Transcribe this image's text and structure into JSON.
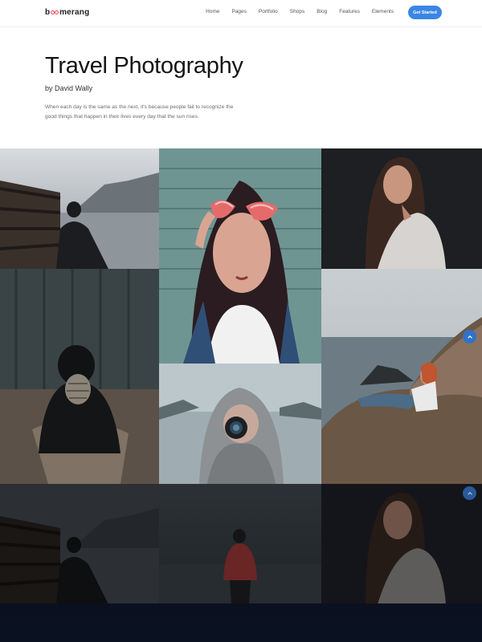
{
  "header": {
    "logo": {
      "prefix": "b",
      "suffix": "merang"
    },
    "nav": [
      "Home",
      "Pages",
      "Portfolio",
      "Shops",
      "Blog",
      "Features",
      "Elements"
    ],
    "cta_label": "Get Started"
  },
  "hero": {
    "title": "Travel Photography",
    "author": "by David Wally",
    "description": "When each day is the same as the next, it's because people fail to recognize the good things that happen in their lives every day that the sun rises."
  },
  "colors": {
    "accent": "#3a86e6",
    "logo_accent": "#e94d4d",
    "scroll_button": "#2f72c9"
  },
  "icons": {
    "scroll_top": "chevron-up-icon"
  }
}
